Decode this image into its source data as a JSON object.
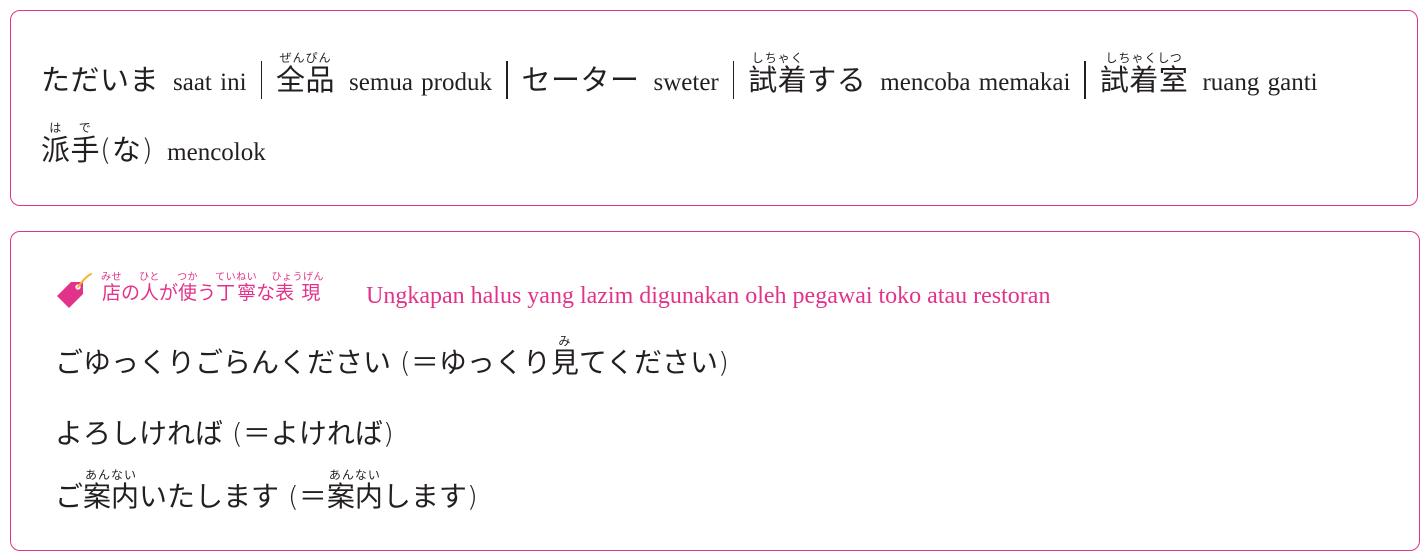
{
  "vocab": {
    "items": [
      {
        "jp": "ただいま",
        "reading": "",
        "id": "saat ini"
      },
      {
        "jp": "全品",
        "reading": "ぜんぴん",
        "id": "semua produk"
      },
      {
        "jp": "セーター",
        "reading": "",
        "id": "sweter"
      },
      {
        "jp_kanji": "試着",
        "reading": "しちゃく",
        "jp_rest": "する",
        "id": "mencoba memakai"
      },
      {
        "jp": "試着室",
        "reading": "しちゃくしつ",
        "id": "ruang ganti"
      },
      {
        "jp_kanji": "派手",
        "reading_1": "は",
        "reading_2": "で",
        "jp_kanji_1": "派",
        "jp_kanji_2": "手",
        "jp_rest": "(な)",
        "id": "mencolok"
      }
    ]
  },
  "polite": {
    "title_parts": [
      {
        "kanji": "店",
        "reading": "みせ"
      },
      {
        "text": "の"
      },
      {
        "kanji": "人",
        "reading": "ひと"
      },
      {
        "text": "が"
      },
      {
        "kanji": "使",
        "reading": "つか"
      },
      {
        "text": "う"
      },
      {
        "kanji": "丁寧",
        "reading": "ていねい"
      },
      {
        "text": "な"
      },
      {
        "kanji": "表現",
        "reading": "ひょうげん"
      }
    ],
    "description": "Ungkapan halus yang lazim digunakan oleh pegawai toko atau restoran",
    "phrases": [
      {
        "before": "ごゆっくりごらんください (＝ゆっくり",
        "kanji": "見",
        "reading": "み",
        "after": "てください)"
      },
      {
        "text": "よろしければ (＝よければ)"
      },
      {
        "before": "ご",
        "kanji": "案内",
        "reading": "あんない",
        "middle": "いたします (＝",
        "kanji2": "案内",
        "reading2": "あんない",
        "after": "します)"
      }
    ],
    "icon": "price-tag-icon",
    "accent_color": "#e2338a"
  }
}
